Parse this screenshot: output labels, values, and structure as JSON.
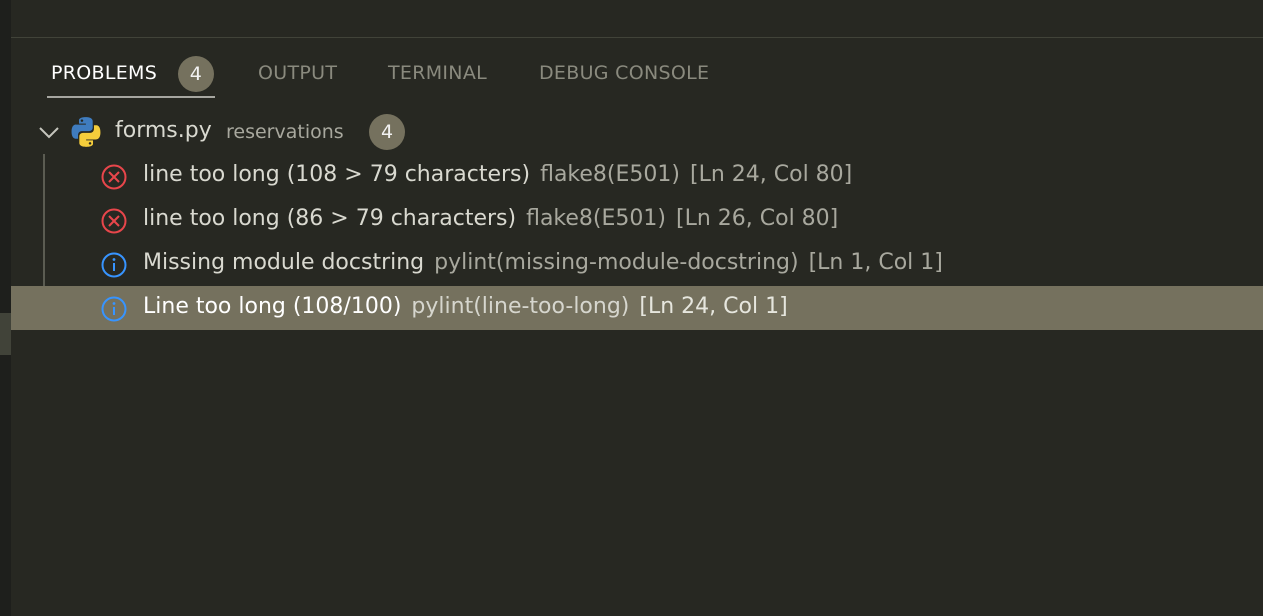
{
  "panel": {
    "tabs": [
      {
        "label": "PROBLEMS",
        "active": true,
        "badge": "4"
      },
      {
        "label": "OUTPUT",
        "active": false
      },
      {
        "label": "TERMINAL",
        "active": false
      },
      {
        "label": "DEBUG CONSOLE",
        "active": false
      }
    ]
  },
  "tree": {
    "file": {
      "name": "forms.py",
      "directory": "reservations",
      "count": "4",
      "icon": "python-icon",
      "expanded": true
    },
    "problems": [
      {
        "severity": "error",
        "message": "line too long (108 > 79 characters)",
        "source": "flake8(E501)",
        "location": "[Ln 24, Col 80]",
        "selected": false
      },
      {
        "severity": "error",
        "message": "line too long (86 > 79 characters)",
        "source": "flake8(E501)",
        "location": "[Ln 26, Col 80]",
        "selected": false
      },
      {
        "severity": "info",
        "message": "Missing module docstring",
        "source": "pylint(missing-module-docstring)",
        "location": "[Ln 1, Col 1]",
        "selected": false
      },
      {
        "severity": "info",
        "message": "Line too long (108/100)",
        "source": "pylint(line-too-long)",
        "location": "[Ln 24, Col 1]",
        "selected": true
      }
    ]
  },
  "colors": {
    "background": "#272822",
    "selection": "#75715e",
    "error": "#e8464b",
    "info": "#3794ff",
    "badge": "#75715e"
  }
}
